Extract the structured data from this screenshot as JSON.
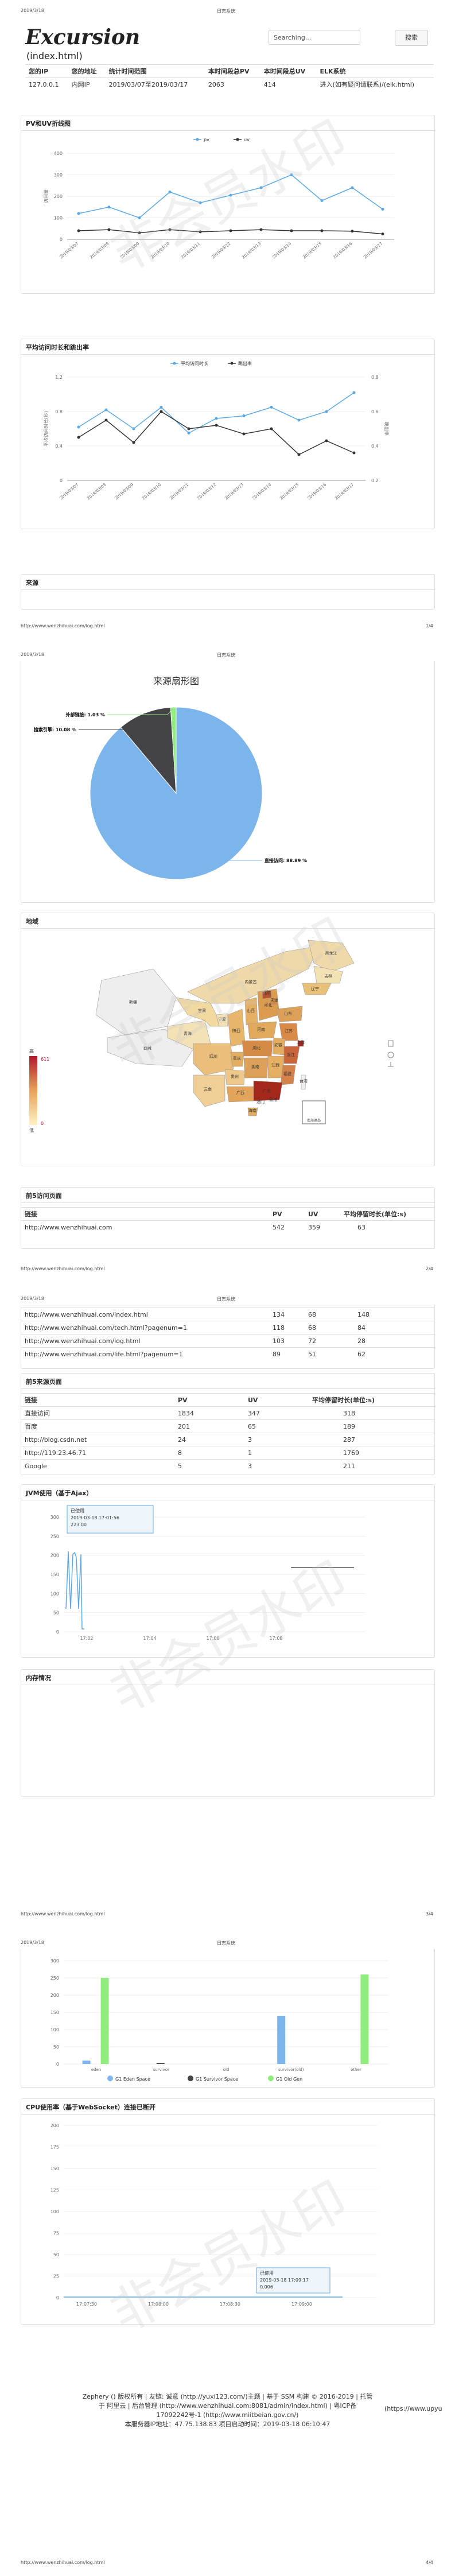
{
  "print_header": {
    "date": "2019/3/18",
    "title": "日志系统"
  },
  "print_footer": {
    "url": "http://www.wenzhihuai.com/log.html",
    "pages": [
      "1/4",
      "2/4",
      "3/4",
      "4/4"
    ]
  },
  "watermark": "非会员水印",
  "brand": {
    "title": "Excursion",
    "subtitle": "(index.html)"
  },
  "search": {
    "placeholder": "Searching...",
    "button": "搜索"
  },
  "summary": {
    "headers": [
      "您的IP",
      "您的地址",
      "统计时间范围",
      "本时间段总PV",
      "本时间段总UV",
      "ELK系统"
    ],
    "row": [
      "127.0.0.1",
      "内网IP",
      "2019/03/07至2019/03/17",
      "2063",
      "414",
      "进入(如有疑问请联系)/(elk.html)"
    ]
  },
  "panels": {
    "pvuv": "PV和UV折线图",
    "avg": "平均访问时长和跳出率",
    "source": "来源",
    "region": "地域",
    "top5pages": "前5访问页面",
    "top5sources": "前5来源页面",
    "jvm": "JVM使用（基于Ajax）",
    "memory": "内存情况",
    "cpu": "CPU使用率（基于WebSocket）连接已断开"
  },
  "chart_data": [
    {
      "type": "line",
      "title": "PV和UV折线图",
      "x": [
        "2019/03/07",
        "2019/03/08",
        "2019/03/09",
        "2019/03/10",
        "2019/03/11",
        "2019/03/12",
        "2019/03/13",
        "2019/03/14",
        "2019/03/15",
        "2019/03/16",
        "2019/03/17"
      ],
      "series": [
        {
          "name": "pv",
          "color": "#5aa9e6",
          "values": [
            120,
            150,
            100,
            220,
            170,
            205,
            240,
            300,
            180,
            240,
            140
          ]
        },
        {
          "name": "uv",
          "color": "#333333",
          "values": [
            40,
            45,
            30,
            45,
            35,
            40,
            45,
            40,
            40,
            38,
            25
          ]
        }
      ],
      "yticks": [
        0,
        100,
        200,
        300,
        400
      ],
      "ylabel": "访问量",
      "ylim": [
        0,
        400
      ],
      "legend": "top"
    },
    {
      "type": "line",
      "title": "平均访问时长和跳出率",
      "x": [
        "2019/03/07",
        "2019/03/08",
        "2019/03/09",
        "2019/03/10",
        "2019/03/11",
        "2019/03/12",
        "2019/03/13",
        "2019/03/14",
        "2019/03/15",
        "2019/03/16",
        "2019/03/17"
      ],
      "series": [
        {
          "name": "平均访问时长",
          "color": "#5aa9e6",
          "axis": "left",
          "values": [
            0.62,
            0.82,
            0.6,
            0.85,
            0.55,
            0.72,
            0.75,
            0.85,
            0.7,
            0.8,
            1.02
          ]
        },
        {
          "name": "跳出率",
          "color": "#333333",
          "axis": "right",
          "values": [
            0.45,
            0.55,
            0.42,
            0.6,
            0.5,
            0.52,
            0.47,
            0.5,
            0.35,
            0.43,
            0.36
          ]
        }
      ],
      "left_ticks": [
        0,
        0.4,
        0.8,
        1.2
      ],
      "right_ticks": [
        0.2,
        0.4,
        0.6,
        0.8
      ],
      "ylabel_left": "平均访问时长(秒)",
      "ylabel_right": "跳出率",
      "legend": "top"
    },
    {
      "type": "pie",
      "title": "来源扇形图",
      "slices": [
        {
          "label": "直接访问",
          "value": 88.89,
          "text": "直接访问: 88.89 %",
          "color": "#7cb5ec"
        },
        {
          "label": "搜索引擎",
          "value": 10.08,
          "text": "搜索引擎: 10.08 %",
          "color": "#434348"
        },
        {
          "label": "外部链接",
          "value": 1.03,
          "text": "外部链接: 1.03 %",
          "color": "#90ed7d"
        }
      ]
    },
    {
      "type": "heatmap",
      "title": "地域",
      "visual_map": {
        "min": "0",
        "max": "611",
        "label_top": "高",
        "label_bottom": "低"
      },
      "provinces": [
        "新疆",
        "西藏",
        "青海",
        "甘肃",
        "宁夏",
        "陕西",
        "四川",
        "重庆",
        "云南",
        "贵州",
        "广西",
        "广东",
        "湖南",
        "湖北",
        "河南",
        "山西",
        "河北",
        "北京",
        "天津",
        "山东",
        "江苏",
        "上海",
        "浙江",
        "安徽",
        "江西",
        "福建",
        "台湾",
        "海南",
        "黑龙江",
        "吉林",
        "辽宁",
        "内蒙古",
        "香港",
        "澳门",
        "南海诸岛"
      ]
    },
    {
      "type": "bar",
      "title": "内存情况",
      "categories": [
        "eden",
        "survivor",
        "old",
        "survivor(old)",
        "other"
      ],
      "series": [
        {
          "name": "G1 Eden Space",
          "color": "#7cb5ec",
          "values": [
            10,
            0,
            0,
            140,
            0
          ]
        },
        {
          "name": "G1 Survivor Space",
          "color": "#434348",
          "values": [
            0,
            3,
            0,
            0,
            0
          ]
        },
        {
          "name": "G1 Old Gen",
          "color": "#90ed7d",
          "values": [
            250,
            0,
            0,
            0,
            260
          ]
        }
      ],
      "yticks": [
        0,
        50,
        100,
        150,
        200,
        250,
        300
      ],
      "ylim": [
        0,
        300
      ]
    }
  ],
  "jvm_tooltip": {
    "title": "已使用",
    "time": "2019-03-18 17:01:56",
    "value": "223.00"
  },
  "jvm_xticks": [
    "17:02",
    "17:04",
    "17:06",
    "17:08"
  ],
  "jvm_yticks": [
    "0",
    "50",
    "100",
    "150",
    "200",
    "250",
    "300"
  ],
  "cpu_tooltip": {
    "title": "已使用",
    "time": "2019-03-18 17:09:17",
    "value": "0.006"
  },
  "cpu_xticks": [
    "17:07:30",
    "17:08:00",
    "17:08:30",
    "17:09:00"
  ],
  "cpu_yticks": [
    "0",
    "25",
    "50",
    "75",
    "100",
    "125",
    "150",
    "175",
    "200"
  ],
  "top5_pages": {
    "headers": [
      "链接",
      "PV",
      "UV",
      "平均停留时长(单位:s)"
    ],
    "rows": [
      [
        "http://www.wenzhihuai.com",
        "542",
        "359",
        "63"
      ],
      [
        "http://www.wenzhihuai.com/index.html",
        "134",
        "68",
        "148"
      ],
      [
        "http://www.wenzhihuai.com/tech.html?pagenum=1",
        "118",
        "68",
        "84"
      ],
      [
        "http://www.wenzhihuai.com/log.html",
        "103",
        "72",
        "28"
      ],
      [
        "http://www.wenzhihuai.com/life.html?pagenum=1",
        "89",
        "51",
        "62"
      ]
    ]
  },
  "top5_sources": {
    "headers": [
      "链接",
      "PV",
      "UV",
      "平均停留时长(单位:s)"
    ],
    "rows": [
      [
        "直接访问",
        "1834",
        "347",
        "318"
      ],
      [
        "百度",
        "201",
        "65",
        "189"
      ],
      [
        "http://blog.csdn.net",
        "24",
        "3",
        "287"
      ],
      [
        "http://119.23.46.71",
        "8",
        "1",
        "1769"
      ],
      [
        "Google",
        "5",
        "3",
        "211"
      ]
    ]
  },
  "site_footer": {
    "line1": "Zephery () 版权所有 | 友链: 诚意 (http://yuxi123.com/)主题 | 基于 SSM 构建 © 2016-2019 | 托管",
    "line2": "于 阿里云 | 后台管理 (http://www.wenzhihuai.com:8081/admin/index.html) | 粤ICP备",
    "line3": "17092242号-1 (http://www.miitbeian.gov.cn/)",
    "line4": "本服务器IP地址：47.75.138.83        项目启动时间：2019-03-18 06:10:47",
    "right": "(https://www.upyu"
  }
}
